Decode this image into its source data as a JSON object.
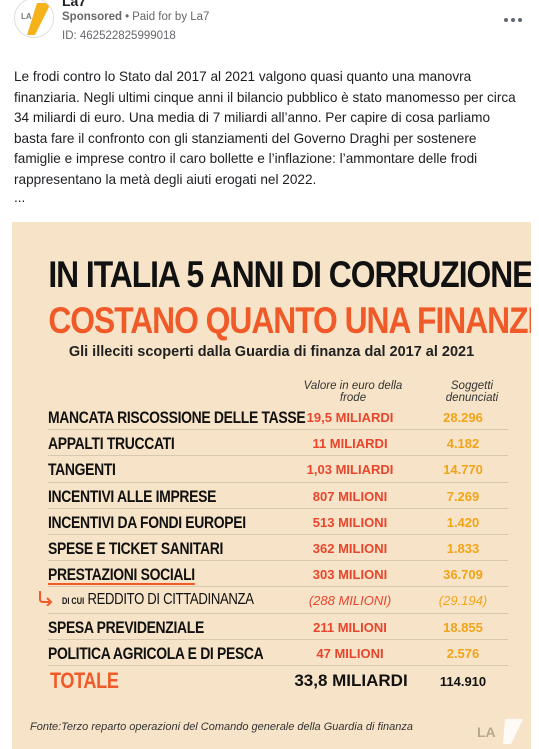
{
  "header": {
    "page_name": "La7",
    "sponsored": "Sponsored",
    "paid_for": "Paid for by La7",
    "ad_id": "ID: 462522825999018"
  },
  "post": {
    "text": "Le frodi contro lo Stato dal 2017 al 2021 valgono quasi quanto una manovra finanziaria. Negli ultimi cinque anni il bilancio pubblico è stato manomesso per circa 34 miliardi di euro. Una media di 7 miliardi all’anno. Per capire di cosa parliamo basta fare il confronto con gli stanziamenti del Governo Draghi per sostenere famiglie e imprese contro il caro bollette e l’inflazione: l’ammontare delle frodi rappresentano la metà degli aiuti erogati nel 2022.",
    "ellipsis": "..."
  },
  "creative": {
    "title_line1": "IN ITALIA 5 ANNI DI CORRUZIONE",
    "title_line2": "COSTANO QUANTO UNA FINANZIARIA",
    "subtitle": "Gli illeciti scoperti dalla Guardia di finanza dal 2017 al 2021",
    "col_value_header": "Valore in euro della frode",
    "col_count_header": "Soggetti denunciati",
    "rows": [
      {
        "label": "MANCATA RISCOSSIONE DELLE TASSE",
        "value": "19,5 MILIARDI",
        "count": "28.296"
      },
      {
        "label": "APPALTI TRUCCATI",
        "value": "11 MILIARDI",
        "count": "4.182"
      },
      {
        "label": "TANGENTI",
        "value": "1,03 MILIARDI",
        "count": "14.770"
      },
      {
        "label": "INCENTIVI ALLE IMPRESE",
        "value": "807 MILIONI",
        "count": "7.269"
      },
      {
        "label": "INCENTIVI DA FONDI EUROPEI",
        "value": "513 MILIONI",
        "count": "1.420"
      },
      {
        "label": "SPESE E TICKET SANITARI",
        "value": "362 MILIONI",
        "count": "1.833"
      },
      {
        "label": "PRESTAZIONI SOCIALI",
        "value": "303 MILIONI",
        "count": "36.709"
      }
    ],
    "sub_row": {
      "prefix": "DI CUI",
      "label": "REDDITO DI CITTADINANZA",
      "value": "(288 MILIONI)",
      "count": "(29.194)"
    },
    "rows2": [
      {
        "label": "SPESA PREVIDENZIALE",
        "value": "211 MILIONI",
        "count": "18.855"
      },
      {
        "label": "POLITICA AGRICOLA E DI PESCA",
        "value": "47 MILIONI",
        "count": "2.576"
      }
    ],
    "total": {
      "label": "TOTALE",
      "value": "33,8 MILIARDI",
      "count": "114.910"
    },
    "source": "Fonte:Terzo reparto operazioni del Comando generale della Guardia di finanza",
    "accent_color": "#f05a28",
    "count_color": "#f0a418",
    "background_color": "#f7e4c8"
  }
}
